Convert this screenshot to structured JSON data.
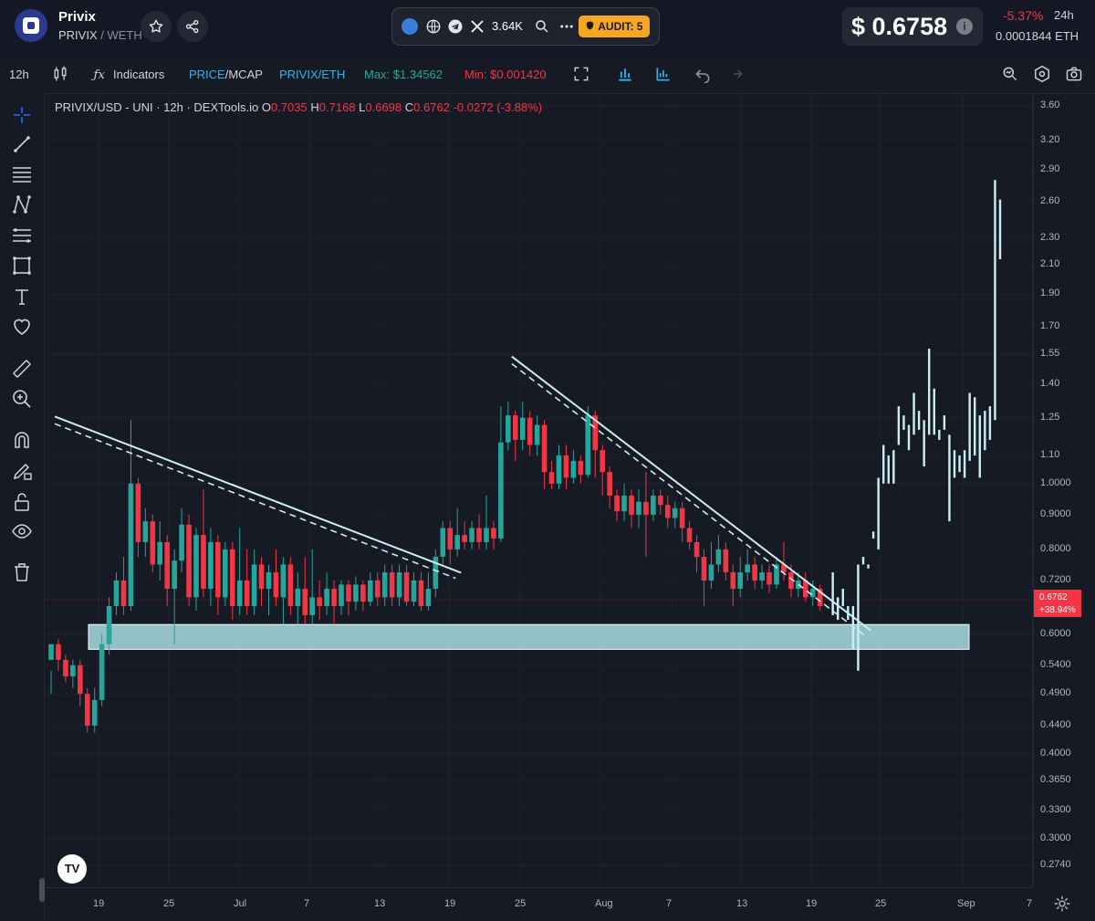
{
  "header": {
    "token_name": "Privix",
    "pair_base": "PRIVIX",
    "pair_sep": " / ",
    "pair_quote": "WETH",
    "social_count": "3.64K",
    "audit_label": "AUDIT: 5",
    "price": "$ 0.6758",
    "info_label": "i",
    "change": "-5.37%",
    "change_period": "24h",
    "eth_price": "0.0001844 ETH"
  },
  "toolbar": {
    "interval": "12h",
    "indicators_label": "Indicators",
    "price_label": "PRICE",
    "mcap_label": "/MCAP",
    "pair_base": "PRIVIX",
    "pair_quote": "/ETH",
    "max_label": "Max: $1.34562",
    "min_label": "Min: $0.001420"
  },
  "legend": {
    "symbol": "PRIVIX/USD - UNI · 12h · DEXTools.io",
    "open_key": "O",
    "open": "0.7035",
    "high_key": "H",
    "high": "0.7168",
    "low_key": "L",
    "low": "0.6698",
    "close_key": "C",
    "close": "0.6762",
    "change": "-0.0272 (-3.88%)"
  },
  "colors": {
    "up": "#26a69a",
    "down": "#f23645",
    "projection": "#c9eff2",
    "zone": "#a9dde3",
    "background": "#161a25"
  },
  "chart_data": {
    "type": "candlestick",
    "y_scale": "log",
    "ylim": [
      0.24,
      3.8
    ],
    "y_ticks": [
      "3.60",
      "3.20",
      "2.90",
      "2.60",
      "2.30",
      "2.10",
      "1.90",
      "1.70",
      "1.55",
      "1.40",
      "1.25",
      "1.10",
      "1.0000",
      "0.9000",
      "0.8000",
      "0.7200",
      "0.6000",
      "0.5400",
      "0.4900",
      "0.4400",
      "0.4000",
      "0.3650",
      "0.3300",
      "0.3000",
      "0.2740"
    ],
    "x_ticks": [
      "19",
      "25",
      "Jul",
      "7",
      "13",
      "19",
      "25",
      "Aug",
      "7",
      "13",
      "19",
      "25",
      "Sep",
      "7"
    ],
    "current_price_label": "0.6762",
    "current_change_label": "+38.94%",
    "support_zone": [
      0.57,
      0.62
    ],
    "candles": [
      [
        0.55,
        0.58,
        0.53,
        0.49
      ],
      [
        0.58,
        0.55,
        0.59,
        0.53
      ],
      [
        0.55,
        0.52,
        0.56,
        0.51
      ],
      [
        0.52,
        0.54,
        0.55,
        0.5
      ],
      [
        0.54,
        0.49,
        0.55,
        0.47
      ],
      [
        0.49,
        0.44,
        0.5,
        0.43
      ],
      [
        0.44,
        0.48,
        0.5,
        0.43
      ],
      [
        0.48,
        0.58,
        0.6,
        0.47
      ],
      [
        0.58,
        0.66,
        0.68,
        0.56
      ],
      [
        0.66,
        0.72,
        0.74,
        0.64
      ],
      [
        0.72,
        0.66,
        0.78,
        0.64
      ],
      [
        0.66,
        1.0,
        1.24,
        0.65
      ],
      [
        1.0,
        0.82,
        1.02,
        0.78
      ],
      [
        0.82,
        0.88,
        0.92,
        0.78
      ],
      [
        0.88,
        0.76,
        0.9,
        0.74
      ],
      [
        0.76,
        0.82,
        0.88,
        0.72
      ],
      [
        0.82,
        0.7,
        0.84,
        0.66
      ],
      [
        0.7,
        0.77,
        0.8,
        0.58
      ],
      [
        0.77,
        0.87,
        0.92,
        0.74
      ],
      [
        0.87,
        0.68,
        0.9,
        0.66
      ],
      [
        0.68,
        0.84,
        0.86,
        0.65
      ],
      [
        0.84,
        0.7,
        0.98,
        0.68
      ],
      [
        0.7,
        0.82,
        0.86,
        0.66
      ],
      [
        0.82,
        0.68,
        0.84,
        0.64
      ],
      [
        0.68,
        0.8,
        0.82,
        0.66
      ],
      [
        0.8,
        0.66,
        0.82,
        0.63
      ],
      [
        0.66,
        0.72,
        0.86,
        0.64
      ],
      [
        0.72,
        0.66,
        0.8,
        0.64
      ],
      [
        0.66,
        0.76,
        0.8,
        0.64
      ],
      [
        0.76,
        0.7,
        0.78,
        0.66
      ],
      [
        0.7,
        0.74,
        0.76,
        0.64
      ],
      [
        0.74,
        0.68,
        0.8,
        0.66
      ],
      [
        0.68,
        0.76,
        0.78,
        0.62
      ],
      [
        0.76,
        0.66,
        0.78,
        0.64
      ],
      [
        0.66,
        0.7,
        0.74,
        0.62
      ],
      [
        0.7,
        0.64,
        0.78,
        0.62
      ],
      [
        0.64,
        0.68,
        0.8,
        0.62
      ],
      [
        0.68,
        0.66,
        0.72,
        0.63
      ],
      [
        0.66,
        0.7,
        0.74,
        0.64
      ],
      [
        0.7,
        0.66,
        0.72,
        0.62
      ],
      [
        0.66,
        0.71,
        0.72,
        0.64
      ],
      [
        0.71,
        0.67,
        0.72,
        0.64
      ],
      [
        0.67,
        0.71,
        0.73,
        0.65
      ],
      [
        0.71,
        0.67,
        0.72,
        0.65
      ],
      [
        0.67,
        0.72,
        0.74,
        0.66
      ],
      [
        0.72,
        0.68,
        0.74,
        0.66
      ],
      [
        0.68,
        0.74,
        0.76,
        0.66
      ],
      [
        0.74,
        0.68,
        0.76,
        0.66
      ],
      [
        0.68,
        0.74,
        0.76,
        0.66
      ],
      [
        0.74,
        0.67,
        0.76,
        0.66
      ],
      [
        0.67,
        0.72,
        0.74,
        0.66
      ],
      [
        0.72,
        0.66,
        0.74,
        0.65
      ],
      [
        0.66,
        0.7,
        0.74,
        0.65
      ],
      [
        0.7,
        0.78,
        0.8,
        0.68
      ],
      [
        0.78,
        0.86,
        0.88,
        0.76
      ],
      [
        0.86,
        0.8,
        0.88,
        0.76
      ],
      [
        0.8,
        0.84,
        0.92,
        0.78
      ],
      [
        0.84,
        0.82,
        0.88,
        0.8
      ],
      [
        0.82,
        0.86,
        0.88,
        0.8
      ],
      [
        0.86,
        0.82,
        0.9,
        0.8
      ],
      [
        0.82,
        0.86,
        0.96,
        0.8
      ],
      [
        0.86,
        0.83,
        0.88,
        0.8
      ],
      [
        0.83,
        1.15,
        1.3,
        0.82
      ],
      [
        1.15,
        1.26,
        1.32,
        1.12
      ],
      [
        1.26,
        1.16,
        1.28,
        1.08
      ],
      [
        1.16,
        1.25,
        1.32,
        1.12
      ],
      [
        1.25,
        1.14,
        1.28,
        1.1
      ],
      [
        1.14,
        1.22,
        1.26,
        1.1
      ],
      [
        1.22,
        1.04,
        1.24,
        0.98
      ],
      [
        1.04,
        1.0,
        1.08,
        0.98
      ],
      [
        1.0,
        1.1,
        1.14,
        0.98
      ],
      [
        1.1,
        1.02,
        1.14,
        0.98
      ],
      [
        1.02,
        1.08,
        1.12,
        1.0
      ],
      [
        1.08,
        1.03,
        1.1,
        1.0
      ],
      [
        1.03,
        1.26,
        1.3,
        1.02
      ],
      [
        1.26,
        1.12,
        1.28,
        1.02
      ],
      [
        1.12,
        1.04,
        1.14,
        0.96
      ],
      [
        1.04,
        0.96,
        1.06,
        0.92
      ],
      [
        0.96,
        0.91,
        0.98,
        0.88
      ],
      [
        0.91,
        0.96,
        1.0,
        0.88
      ],
      [
        0.96,
        0.9,
        0.98,
        0.86
      ],
      [
        0.9,
        0.94,
        0.98,
        0.86
      ],
      [
        0.94,
        0.9,
        1.04,
        0.78
      ],
      [
        0.9,
        0.96,
        0.98,
        0.88
      ],
      [
        0.96,
        0.93,
        0.98,
        0.9
      ],
      [
        0.93,
        0.89,
        0.96,
        0.86
      ],
      [
        0.89,
        0.92,
        0.94,
        0.86
      ],
      [
        0.92,
        0.86,
        0.94,
        0.82
      ],
      [
        0.86,
        0.82,
        0.88,
        0.8
      ],
      [
        0.82,
        0.78,
        0.84,
        0.74
      ],
      [
        0.78,
        0.72,
        0.8,
        0.66
      ],
      [
        0.72,
        0.76,
        0.82,
        0.7
      ],
      [
        0.76,
        0.8,
        0.84,
        0.74
      ],
      [
        0.8,
        0.74,
        0.82,
        0.72
      ],
      [
        0.74,
        0.7,
        0.76,
        0.66
      ],
      [
        0.7,
        0.74,
        0.78,
        0.68
      ],
      [
        0.74,
        0.76,
        0.8,
        0.72
      ],
      [
        0.76,
        0.72,
        0.78,
        0.7
      ],
      [
        0.72,
        0.74,
        0.76,
        0.7
      ],
      [
        0.74,
        0.71,
        0.76,
        0.69
      ],
      [
        0.71,
        0.76,
        0.78,
        0.7
      ],
      [
        0.76,
        0.74,
        0.82,
        0.72
      ],
      [
        0.74,
        0.7,
        0.76,
        0.68
      ],
      [
        0.7,
        0.72,
        0.74,
        0.68
      ],
      [
        0.72,
        0.68,
        0.74,
        0.67
      ],
      [
        0.68,
        0.7,
        0.72,
        0.66
      ],
      [
        0.7,
        0.66,
        0.71,
        0.65
      ]
    ],
    "projection_bars": [
      [
        0.64,
        0.74
      ],
      [
        0.63,
        0.68
      ],
      [
        0.66,
        0.7
      ],
      [
        0.63,
        0.66
      ],
      [
        0.57,
        0.66
      ],
      [
        0.53,
        0.76
      ],
      [
        0.76,
        0.78
      ],
      [
        0.75,
        0.76
      ],
      [
        0.83,
        0.85
      ],
      [
        0.8,
        1.02
      ],
      [
        1.0,
        1.14
      ],
      [
        1.0,
        1.1
      ],
      [
        1.0,
        1.12
      ],
      [
        1.14,
        1.3
      ],
      [
        1.2,
        1.26
      ],
      [
        1.12,
        1.22
      ],
      [
        1.18,
        1.36
      ],
      [
        1.2,
        1.28
      ],
      [
        1.06,
        1.24
      ],
      [
        1.18,
        1.58
      ],
      [
        1.18,
        1.38
      ],
      [
        1.16,
        1.2
      ],
      [
        1.2,
        1.26
      ],
      [
        0.88,
        1.18
      ],
      [
        1.02,
        1.12
      ],
      [
        1.04,
        1.1
      ],
      [
        1.02,
        1.12
      ],
      [
        1.08,
        1.36
      ],
      [
        1.1,
        1.34
      ],
      [
        1.02,
        1.26
      ],
      [
        1.12,
        1.28
      ],
      [
        1.16,
        1.3
      ],
      [
        1.24,
        2.8
      ],
      [
        2.14,
        2.62
      ]
    ],
    "trendlines": [
      [
        [
          0,
          1.24
        ],
        [
          56,
          0.73
        ]
      ],
      [
        [
          63,
          1.52
        ],
        [
          113,
          0.6
        ]
      ]
    ]
  }
}
